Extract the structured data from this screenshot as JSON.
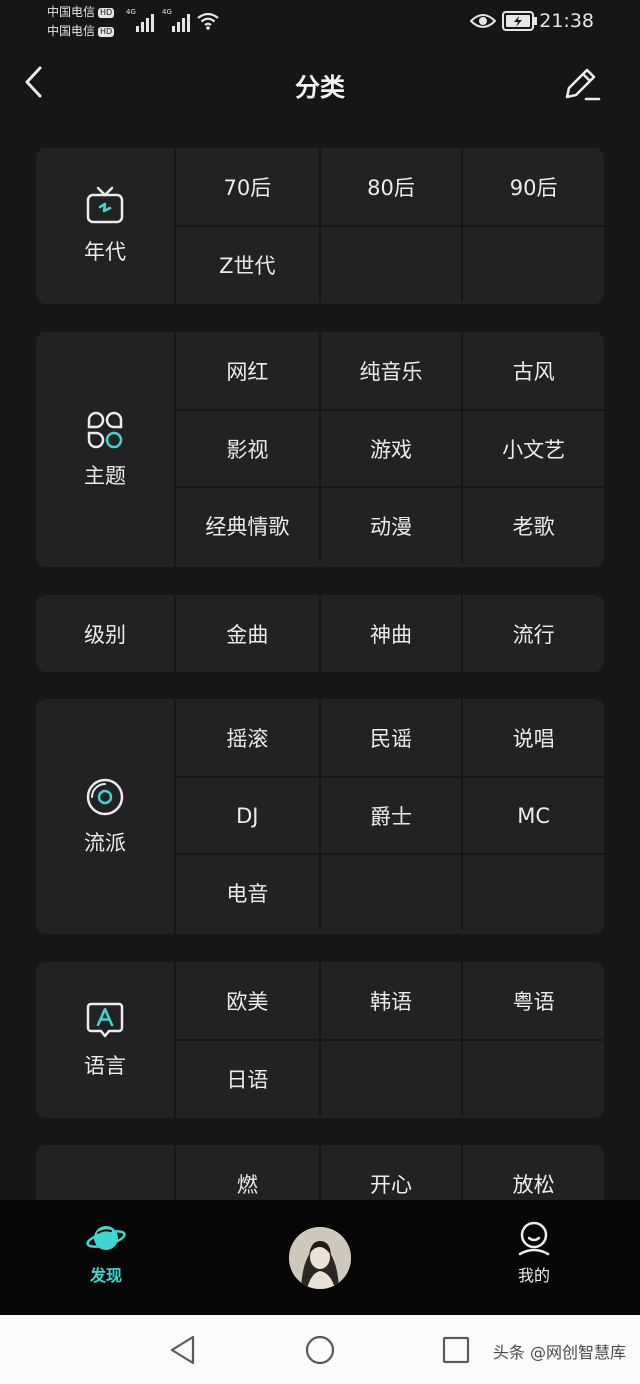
{
  "status": {
    "carrier1": "中国电信",
    "carrier2": "中国电信",
    "hd": "HD",
    "net1": "4G",
    "net2": "4G",
    "time": "21:38"
  },
  "header": {
    "title": "分类"
  },
  "sections": [
    {
      "label": "年代",
      "icon": "tv-icon",
      "items": [
        "70后",
        "80后",
        "90后",
        "Z世代"
      ]
    },
    {
      "label": "主题",
      "icon": "themes-icon",
      "items": [
        "网红",
        "纯音乐",
        "古风",
        "影视",
        "游戏",
        "小文艺",
        "经典情歌",
        "动漫",
        "老歌"
      ]
    },
    {
      "label": "级别",
      "icon": "",
      "items": [
        "金曲",
        "神曲",
        "流行"
      ]
    },
    {
      "label": "流派",
      "icon": "vinyl-icon",
      "items": [
        "摇滚",
        "民谣",
        "说唱",
        "DJ",
        "爵士",
        "MC",
        "电音"
      ]
    },
    {
      "label": "语言",
      "icon": "language-icon",
      "items": [
        "欧美",
        "韩语",
        "粤语",
        "日语"
      ]
    },
    {
      "label": "",
      "icon": "",
      "items": [
        "燃",
        "开心",
        "放松"
      ]
    }
  ],
  "bottom_nav": {
    "discover": "发现",
    "mine": "我的"
  },
  "watermark": "头条 @网创智慧库",
  "colors": {
    "accent": "#3ed8d0",
    "background": "#161616",
    "card": "#222224"
  }
}
